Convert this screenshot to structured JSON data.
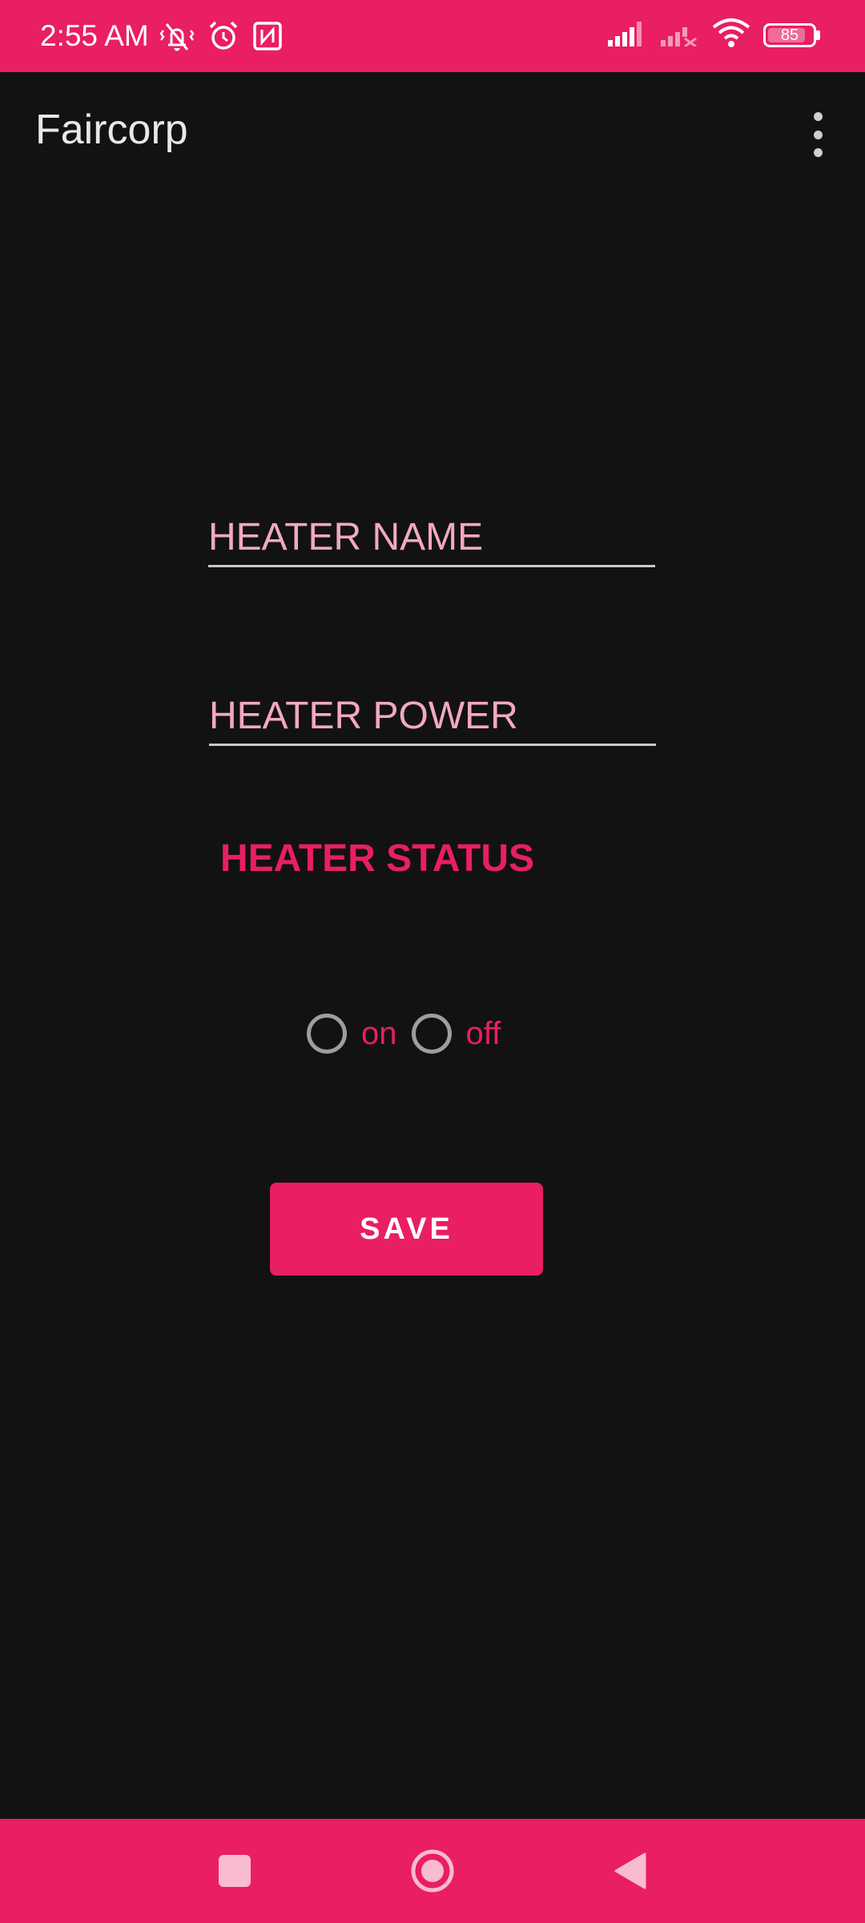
{
  "status_bar": {
    "time": "2:55 AM",
    "battery_level": "85",
    "battery_fraction": 0.85,
    "icons": [
      "vibrate-muted-icon",
      "alarm-icon",
      "nfc-icon",
      "signal-icon",
      "signal-off-icon",
      "wifi-icon",
      "battery-icon"
    ]
  },
  "app_bar": {
    "title": "Faircorp",
    "menu_icon": "overflow-menu-icon"
  },
  "form": {
    "heater_name_placeholder": "HEATER NAME",
    "heater_power_placeholder": "HEATER POWER",
    "status_label": "HEATER STATUS",
    "options": [
      {
        "label": "on",
        "selected": false
      },
      {
        "label": "off",
        "selected": false
      }
    ],
    "save_label": "SAVE"
  },
  "nav_bar": {
    "icons": [
      "recents-icon",
      "home-icon",
      "back-icon"
    ]
  },
  "colors": {
    "accent": "#E91E63",
    "background": "#121212",
    "placeholder": "#F3A8C2"
  }
}
